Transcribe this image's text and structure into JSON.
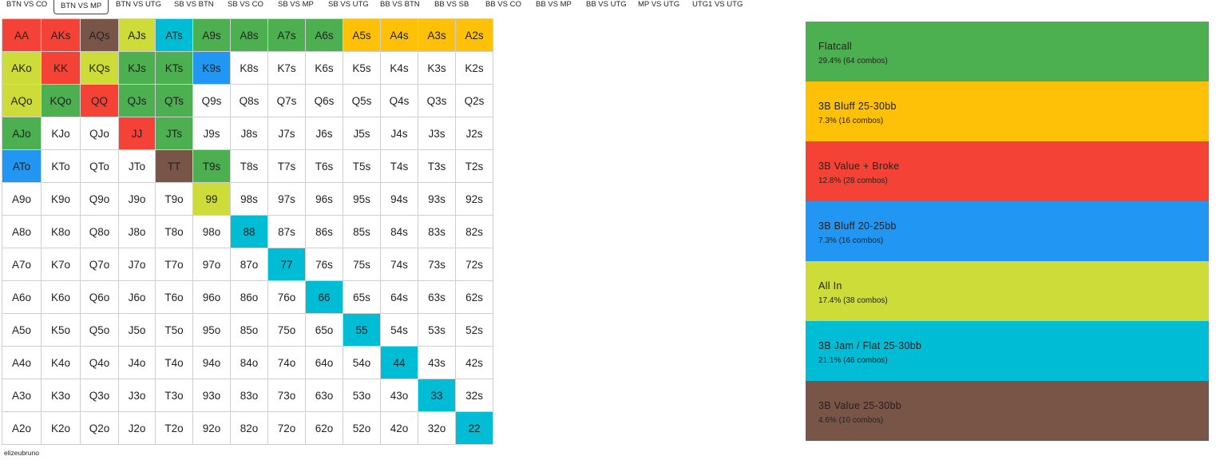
{
  "tabs": [
    {
      "label": "BTN VS CO",
      "active": false
    },
    {
      "label": "BTN VS MP",
      "active": true
    },
    {
      "label": "BTN VS UTG",
      "active": false
    },
    {
      "label": "SB VS BTN",
      "active": false
    },
    {
      "label": "SB VS CO",
      "active": false
    },
    {
      "label": "SB VS MP",
      "active": false
    },
    {
      "label": "SB VS UTG",
      "active": false
    },
    {
      "label": "BB VS BTN",
      "active": false
    },
    {
      "label": "BB VS SB",
      "active": false
    },
    {
      "label": "BB VS CO",
      "active": false
    },
    {
      "label": "BB VS MP",
      "active": false
    },
    {
      "label": "BB VS UTG",
      "active": false
    },
    {
      "label": "MP VS UTG",
      "active": false
    },
    {
      "label": "UTG1 VS UTG",
      "active": false
    }
  ],
  "action_colors": {
    "flatcall": "#4caf50",
    "bluff_25_30": "#ffc107",
    "value_broke": "#f44336",
    "bluff_20_25": "#2196f3",
    "all_in": "#cddc39",
    "jam_flat": "#00bcd4",
    "value_25_30": "#795548"
  },
  "grid": {
    "rows": [
      [
        "AA",
        "AKs",
        "AQs",
        "AJs",
        "ATs",
        "A9s",
        "A8s",
        "A7s",
        "A6s",
        "A5s",
        "A4s",
        "A3s",
        "A2s"
      ],
      [
        "AKo",
        "KK",
        "KQs",
        "KJs",
        "KTs",
        "K9s",
        "K8s",
        "K7s",
        "K6s",
        "K5s",
        "K4s",
        "K3s",
        "K2s"
      ],
      [
        "AQo",
        "KQo",
        "QQ",
        "QJs",
        "QTs",
        "Q9s",
        "Q8s",
        "Q7s",
        "Q6s",
        "Q5s",
        "Q4s",
        "Q3s",
        "Q2s"
      ],
      [
        "AJo",
        "KJo",
        "QJo",
        "JJ",
        "JTs",
        "J9s",
        "J8s",
        "J7s",
        "J6s",
        "J5s",
        "J4s",
        "J3s",
        "J2s"
      ],
      [
        "ATo",
        "KTo",
        "QTo",
        "JTo",
        "TT",
        "T9s",
        "T8s",
        "T7s",
        "T6s",
        "T5s",
        "T4s",
        "T3s",
        "T2s"
      ],
      [
        "A9o",
        "K9o",
        "Q9o",
        "J9o",
        "T9o",
        "99",
        "98s",
        "97s",
        "96s",
        "95s",
        "94s",
        "93s",
        "92s"
      ],
      [
        "A8o",
        "K8o",
        "Q8o",
        "J8o",
        "T8o",
        "98o",
        "88",
        "87s",
        "86s",
        "85s",
        "84s",
        "83s",
        "82s"
      ],
      [
        "A7o",
        "K7o",
        "Q7o",
        "J7o",
        "T7o",
        "97o",
        "87o",
        "77",
        "76s",
        "75s",
        "74s",
        "73s",
        "72s"
      ],
      [
        "A6o",
        "K6o",
        "Q6o",
        "J6o",
        "T6o",
        "96o",
        "86o",
        "76o",
        "66",
        "65s",
        "64s",
        "63s",
        "62s"
      ],
      [
        "A5o",
        "K5o",
        "Q5o",
        "J5o",
        "T5o",
        "95o",
        "85o",
        "75o",
        "65o",
        "55",
        "54s",
        "53s",
        "52s"
      ],
      [
        "A4o",
        "K4o",
        "Q4o",
        "J4o",
        "T4o",
        "94o",
        "84o",
        "74o",
        "64o",
        "54o",
        "44",
        "43s",
        "42s"
      ],
      [
        "A3o",
        "K3o",
        "Q3o",
        "J3o",
        "T3o",
        "93o",
        "83o",
        "73o",
        "63o",
        "53o",
        "43o",
        "33",
        "32s"
      ],
      [
        "A2o",
        "K2o",
        "Q2o",
        "J2o",
        "T2o",
        "92o",
        "82o",
        "72o",
        "62o",
        "52o",
        "42o",
        "32o",
        "22"
      ]
    ],
    "hand_actions": {
      "AA": "value_broke",
      "AKs": "value_broke",
      "AQs": "value_25_30",
      "AJs": "all_in",
      "ATs": "jam_flat",
      "A9s": "flatcall",
      "A8s": "flatcall",
      "A7s": "flatcall",
      "A6s": "flatcall",
      "A5s": "bluff_25_30",
      "A4s": "bluff_25_30",
      "A3s": "bluff_25_30",
      "A2s": "bluff_25_30",
      "AKo": "all_in",
      "KK": "value_broke",
      "KQs": "all_in",
      "KJs": "flatcall",
      "KTs": "flatcall",
      "K9s": "bluff_20_25",
      "AQo": "all_in",
      "KQo": "flatcall",
      "QQ": "value_broke",
      "QJs": "flatcall",
      "QTs": "flatcall",
      "AJo": "flatcall",
      "JJ": "value_broke",
      "JTs": "flatcall",
      "ATo": "bluff_20_25",
      "TT": "value_25_30",
      "T9s": "flatcall",
      "99": "all_in",
      "88": "jam_flat",
      "77": "jam_flat",
      "66": "jam_flat",
      "55": "jam_flat",
      "44": "jam_flat",
      "33": "jam_flat",
      "22": "jam_flat"
    }
  },
  "legend": [
    {
      "key": "flatcall",
      "name": "Flatcall",
      "stat": "29.4% (64 combos)"
    },
    {
      "key": "bluff_25_30",
      "name": "3B Bluff 25-30bb",
      "stat": "7.3% (16 combos)"
    },
    {
      "key": "value_broke",
      "name": "3B Value + Broke",
      "stat": "12.8% (28 combos)"
    },
    {
      "key": "bluff_20_25",
      "name": "3B Bluff 20-25bb",
      "stat": "7.3% (16 combos)"
    },
    {
      "key": "all_in",
      "name": "All In",
      "stat": "17.4% (38 combos)"
    },
    {
      "key": "jam_flat",
      "name": "3B Jam / Flat 25-30bb",
      "stat": "21.1% (46 combos)"
    },
    {
      "key": "value_25_30",
      "name": "3B Value 25-30bb",
      "stat": "4.6% (10 combos)"
    }
  ],
  "footer": {
    "author": "elizeubruno"
  }
}
